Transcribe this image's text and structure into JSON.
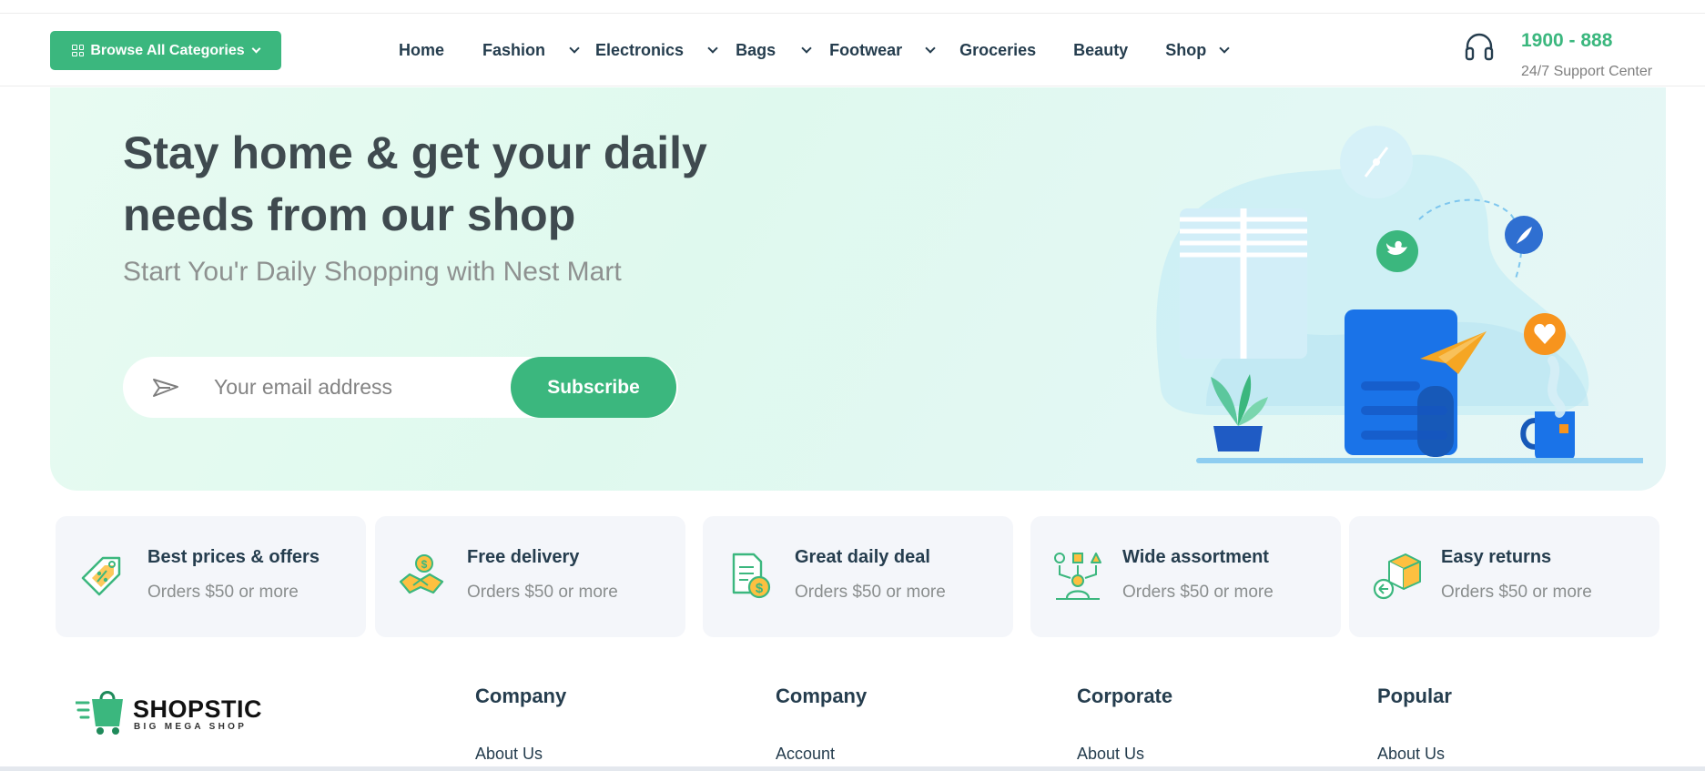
{
  "header": {
    "browse_label": "Browse All Categories",
    "nav": [
      {
        "label": "Home",
        "dropdown": false
      },
      {
        "label": "Fashion",
        "dropdown": true
      },
      {
        "label": "Electronics",
        "dropdown": true
      },
      {
        "label": "Bags",
        "dropdown": true
      },
      {
        "label": "Footwear",
        "dropdown": true
      },
      {
        "label": "Groceries",
        "dropdown": false
      },
      {
        "label": "Beauty",
        "dropdown": false
      },
      {
        "label": "Shop",
        "dropdown": true
      }
    ],
    "support_number": "1900 - 888",
    "support_label": "24/7 Support Center",
    "support_icon": "headset-icon"
  },
  "hero": {
    "title": "Stay home & get your daily needs from our shop",
    "subtitle": "Start You'r Daily Shopping with Nest Mart",
    "email_placeholder": "Your email address",
    "email_value": "",
    "subscribe_label": "Subscribe",
    "input_icon": "paper-plane-icon"
  },
  "features": [
    {
      "title": "Best prices & offers",
      "subtitle": "Orders $50 or more",
      "icon": "price-tag-icon"
    },
    {
      "title": "Free delivery",
      "subtitle": "Orders $50 or more",
      "icon": "delivery-handshake-icon"
    },
    {
      "title": "Great daily deal",
      "subtitle": "Orders $50 or more",
      "icon": "deal-document-icon"
    },
    {
      "title": "Wide assortment",
      "subtitle": "Orders $50 or more",
      "icon": "assortment-icon"
    },
    {
      "title": "Easy returns",
      "subtitle": "Orders $50 or more",
      "icon": "return-box-icon"
    }
  ],
  "footer": {
    "logo_name": "SHOPSTIC",
    "logo_tagline": "BIG MEGA SHOP",
    "columns": [
      {
        "title": "Company",
        "first_link": "About Us"
      },
      {
        "title": "Company",
        "first_link": "Account"
      },
      {
        "title": "Corporate",
        "first_link": "About Us"
      },
      {
        "title": "Popular",
        "first_link": "About Us"
      }
    ]
  },
  "colors": {
    "brand": "#3bb77e",
    "heading": "#253d4e",
    "muted": "#7e7e7e",
    "hero_bg": "#e3f9ef",
    "feature_bg": "#f4f6fa"
  }
}
